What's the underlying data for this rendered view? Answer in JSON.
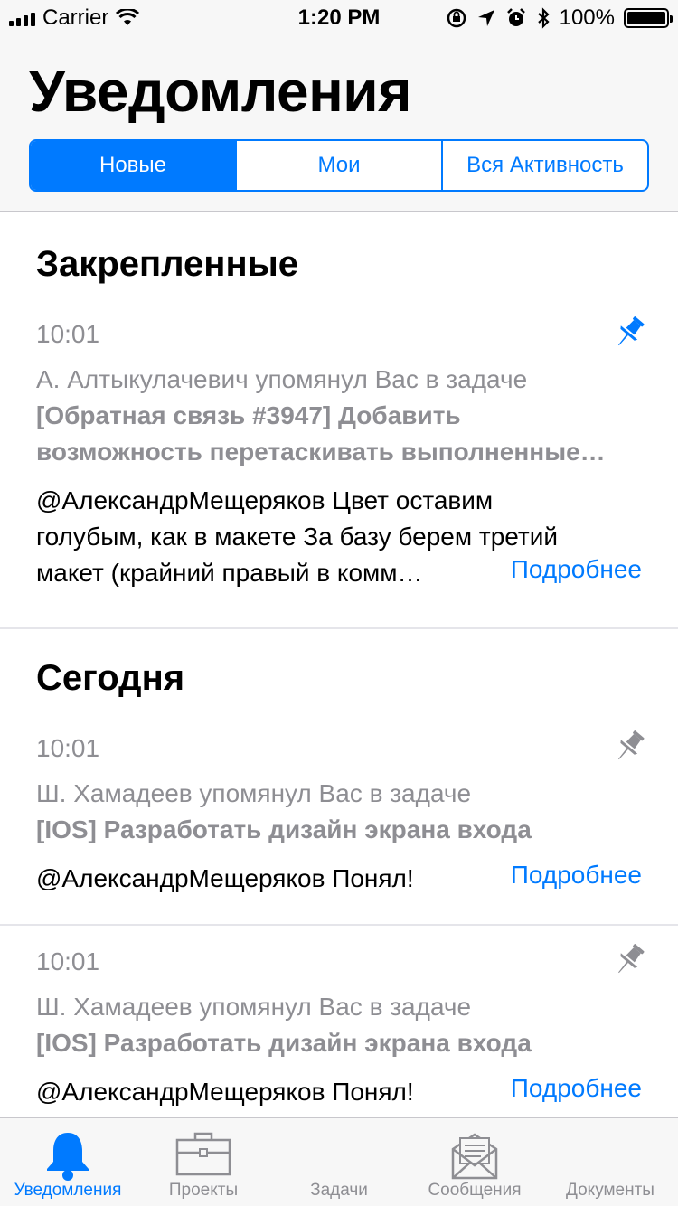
{
  "status_bar": {
    "carrier": "Carrier",
    "time": "1:20 PM",
    "battery": "100%"
  },
  "header": {
    "title": "Уведомления",
    "segments": [
      {
        "label": "Новые",
        "active": true
      },
      {
        "label": "Мои",
        "active": false
      },
      {
        "label": "Вся Активность",
        "active": false
      }
    ]
  },
  "sections": {
    "pinned": {
      "title": "Закрепленные",
      "item": {
        "time": "10:01",
        "mention": "А. Алтыкулачевич упомянул Вас в задаче",
        "task_line1": "[Обратная связь #3947] Добавить",
        "task_line2": "возможность перетаскивать выполненные…",
        "comment_line1": "@АлександрМещеряков  Цвет оставим",
        "comment_line2": "голубым, как в макете За базу берем третий",
        "comment_line3": "макет (крайний правый в комм…",
        "more": "Подробнее",
        "pinned": true
      }
    },
    "today": {
      "title": "Сегодня",
      "items": [
        {
          "time": "10:01",
          "mention": "Ш. Хамадеев упомянул Вас в задаче",
          "task": "[IOS] Разработать дизайн экрана входа",
          "comment": "@АлександрМещеряков Понял!",
          "more": "Подробнее",
          "pinned": false
        },
        {
          "time": "10:01",
          "mention": "Ш. Хамадеев упомянул Вас в задаче",
          "task": "[IOS] Разработать дизайн экрана входа",
          "comment": "@АлександрМещеряков Понял!",
          "more": "Подробнее",
          "pinned": false
        }
      ]
    }
  },
  "tabbar": {
    "tabs": [
      {
        "label": "Уведомления",
        "icon": "bell-icon",
        "active": true
      },
      {
        "label": "Проекты",
        "icon": "briefcase-icon",
        "active": false
      },
      {
        "label": "Задачи",
        "icon": "tasks-icon",
        "active": false
      },
      {
        "label": "Сообщения",
        "icon": "envelope-icon",
        "active": false
      },
      {
        "label": "Документы",
        "icon": "documents-icon",
        "active": false
      }
    ]
  },
  "colors": {
    "accent": "#007aff",
    "secondary_text": "#8e8e93",
    "pin_active": "#007aff",
    "pin_inactive": "#8e8e93"
  }
}
